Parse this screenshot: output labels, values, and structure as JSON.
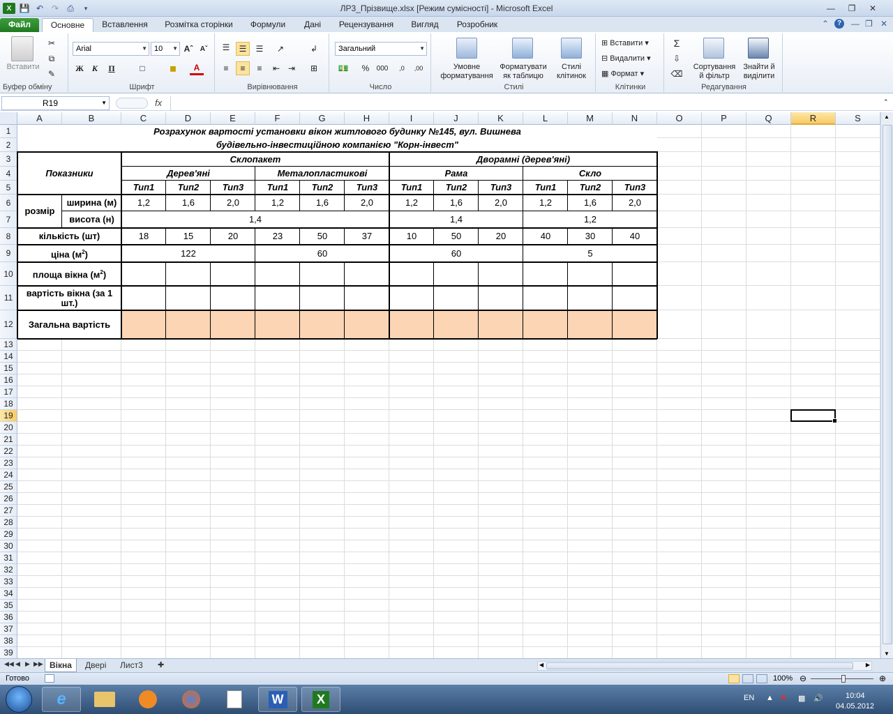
{
  "window": {
    "title": "ЛР3_Прізвище.xlsx  [Режим сумісності]  -  Microsoft Excel"
  },
  "tabs": [
    "Файл",
    "Основне",
    "Вставлення",
    "Розмітка сторінки",
    "Формули",
    "Дані",
    "Рецензування",
    "Вигляд",
    "Розробник"
  ],
  "ribbon": {
    "clipboard": {
      "paste": "Вставити",
      "label": "Буфер обміну"
    },
    "font": {
      "name": "Arial",
      "size": "10",
      "bold": "Ж",
      "italic": "К",
      "underline": "П",
      "label": "Шрифт"
    },
    "alignment": {
      "label": "Вирівнювання"
    },
    "number": {
      "format": "Загальний",
      "percent": "%",
      "thousands": "000",
      "label": "Число"
    },
    "styles": {
      "conditional": "Умовне\nформатування",
      "as_table": "Форматувати\nяк таблицю",
      "cell_styles": "Стилі\nклітинок",
      "label": "Стилі"
    },
    "cells": {
      "insert": "Вставити",
      "delete": "Видалити",
      "format": "Формат",
      "label": "Клітинки"
    },
    "editing": {
      "sigma": "Σ",
      "sort": "Сортування\nй фільтр",
      "find": "Знайти й\nвиділити",
      "label": "Редагування"
    }
  },
  "formula_bar": {
    "name_box": "R19",
    "fx": "fx",
    "value": ""
  },
  "columns": [
    "A",
    "B",
    "C",
    "D",
    "E",
    "F",
    "G",
    "H",
    "I",
    "J",
    "K",
    "L",
    "M",
    "N",
    "O",
    "P",
    "Q",
    "R",
    "S"
  ],
  "selected_column": "R",
  "selected_row": "19",
  "rows": [
    "1",
    "2",
    "3",
    "4",
    "5",
    "6",
    "7",
    "8",
    "9",
    "10",
    "11",
    "12",
    "13",
    "14",
    "15",
    "16",
    "17",
    "18",
    "19",
    "20",
    "21",
    "22",
    "23",
    "24",
    "25",
    "26",
    "27",
    "28",
    "29",
    "30",
    "31",
    "32",
    "33",
    "34",
    "35",
    "36",
    "37",
    "38",
    "39"
  ],
  "sheet": {
    "title1": "Розрахунок вартості установки вікон житлового будинку №145, вул. Вишнева",
    "title2": "будівельно-інвестиційною компанією \"Корн-інвест\"",
    "pokaznyky": "Показники",
    "skloпакет": "Склопакет",
    "dvoramni": "Двoрамні (дерев'яні)",
    "derevyani": "Дерев'яні",
    "metaloplastykovi": "Металопластикові",
    "rama": "Рама",
    "sklo": "Скло",
    "types": [
      "Тип1",
      "Тип2",
      "Тип3",
      "Тип1",
      "Тип2",
      "Тип3",
      "Тип1",
      "Тип2",
      "Тип3",
      "Тип1",
      "Тип2",
      "Тип3"
    ],
    "rozmir": "розмір",
    "shyryna_label": "ширина (м)",
    "shyryna": [
      "1,2",
      "1,6",
      "2,0",
      "1,2",
      "1,6",
      "2,0",
      "1,2",
      "1,6",
      "2,0",
      "1,2",
      "1,6",
      "2,0"
    ],
    "vysota_label": "висота (н)",
    "vysota_a": "1,4",
    "vysota_b": "1,4",
    "vysota_c": "1,2",
    "kilkist_label": "кількість (шт)",
    "kilkist": [
      "18",
      "15",
      "20",
      "23",
      "50",
      "37",
      "10",
      "50",
      "20",
      "40",
      "30",
      "40"
    ],
    "tsina_label": "ціна (м",
    "tsina_sup": "2",
    "tsina_close": ")",
    "tsina": [
      "122",
      "60",
      "60",
      "5"
    ],
    "ploshcha_label": "площа вікна (м",
    "ploshcha_sup": "2",
    "vartist_label": "вартість вікна (за 1 шт.)",
    "zahalna_label": "Загальна вартість"
  },
  "sheet_tabs": [
    "Вікна",
    "Двері",
    "Лист3"
  ],
  "status": {
    "ready": "Готово",
    "zoom": "100%"
  },
  "taskbar": {
    "lang": "EN",
    "time": "10:04",
    "date": "04.05.2012"
  },
  "colors": {
    "accent_green": "#1f7a1f",
    "peach": "#fcd5b4",
    "selection": "#f8cb65"
  }
}
